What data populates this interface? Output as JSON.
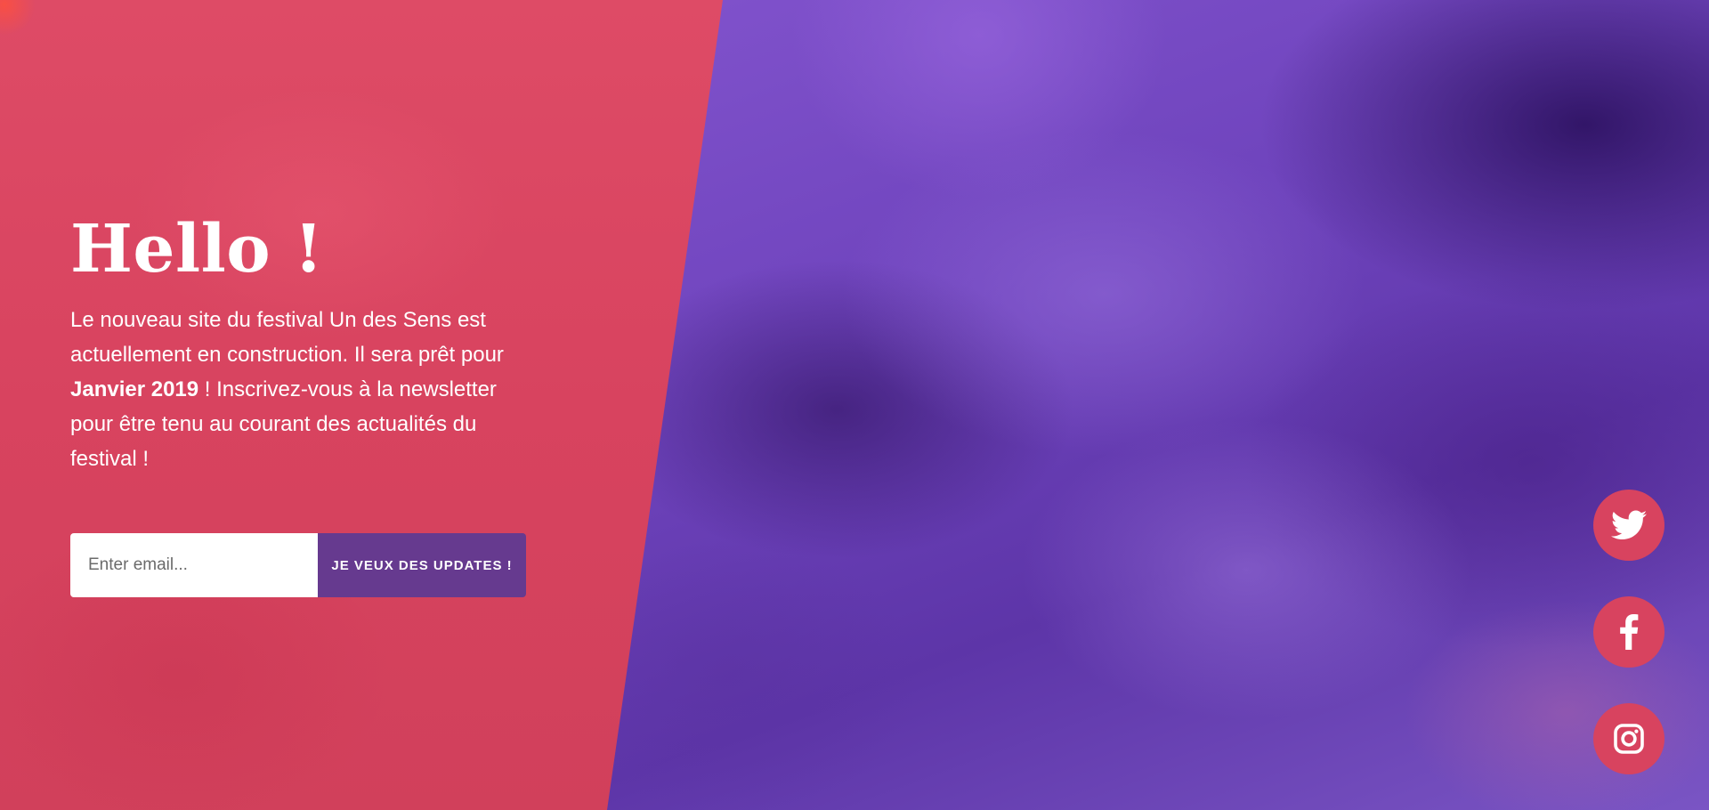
{
  "hero": {
    "title": "Hello !",
    "text_part1": "Le nouveau site du festival Un des Sens est actuellement en construction. Il sera prêt pour ",
    "text_bold": "Janvier 2019",
    "text_part2": " ! Inscrivez-vous à la newsletter pour être tenu au courant des actualités du festival !"
  },
  "newsletter": {
    "email_placeholder": "Enter email...",
    "email_value": "",
    "submit_label": "JE VEUX DES UPDATES !"
  },
  "social": [
    {
      "icon": "twitter-icon"
    },
    {
      "icon": "facebook-icon"
    },
    {
      "icon": "instagram-icon"
    }
  ],
  "colors": {
    "red_panel": "#d8435f",
    "purple_background": "#7a4fc4",
    "button_purple": "#663a8f",
    "white": "#ffffff"
  }
}
